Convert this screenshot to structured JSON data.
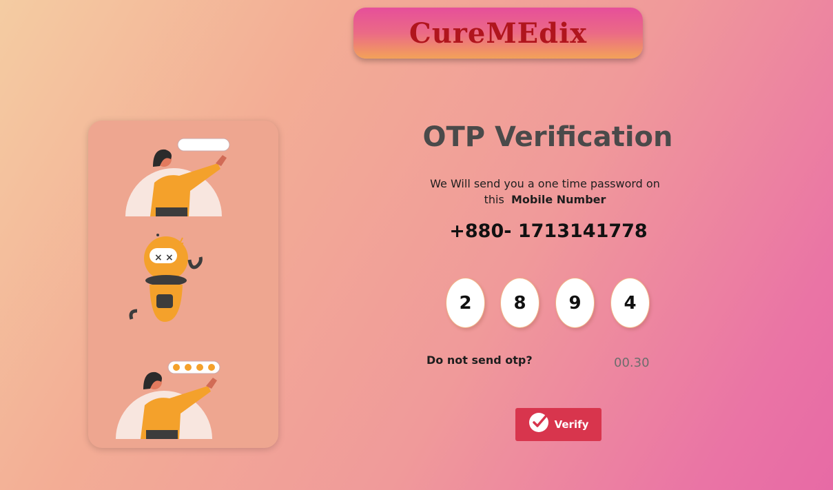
{
  "brand": {
    "title": "CureMEdix"
  },
  "otp": {
    "title": "OTP Verification",
    "description_line1": "We Will send you a one time password on",
    "description_prefix": "this",
    "description_bold": "Mobile Number",
    "phone": "+880- 1713141778",
    "digits": [
      "2",
      "8",
      "9",
      "4"
    ],
    "resend_text": "Do not send otp?",
    "timer": "00.30"
  },
  "verify": {
    "label": "Verify"
  },
  "colors": {
    "brand_text": "#b0151d",
    "button": "#d8354d",
    "card": "#eea690",
    "accent_orange": "#f4a12b"
  }
}
